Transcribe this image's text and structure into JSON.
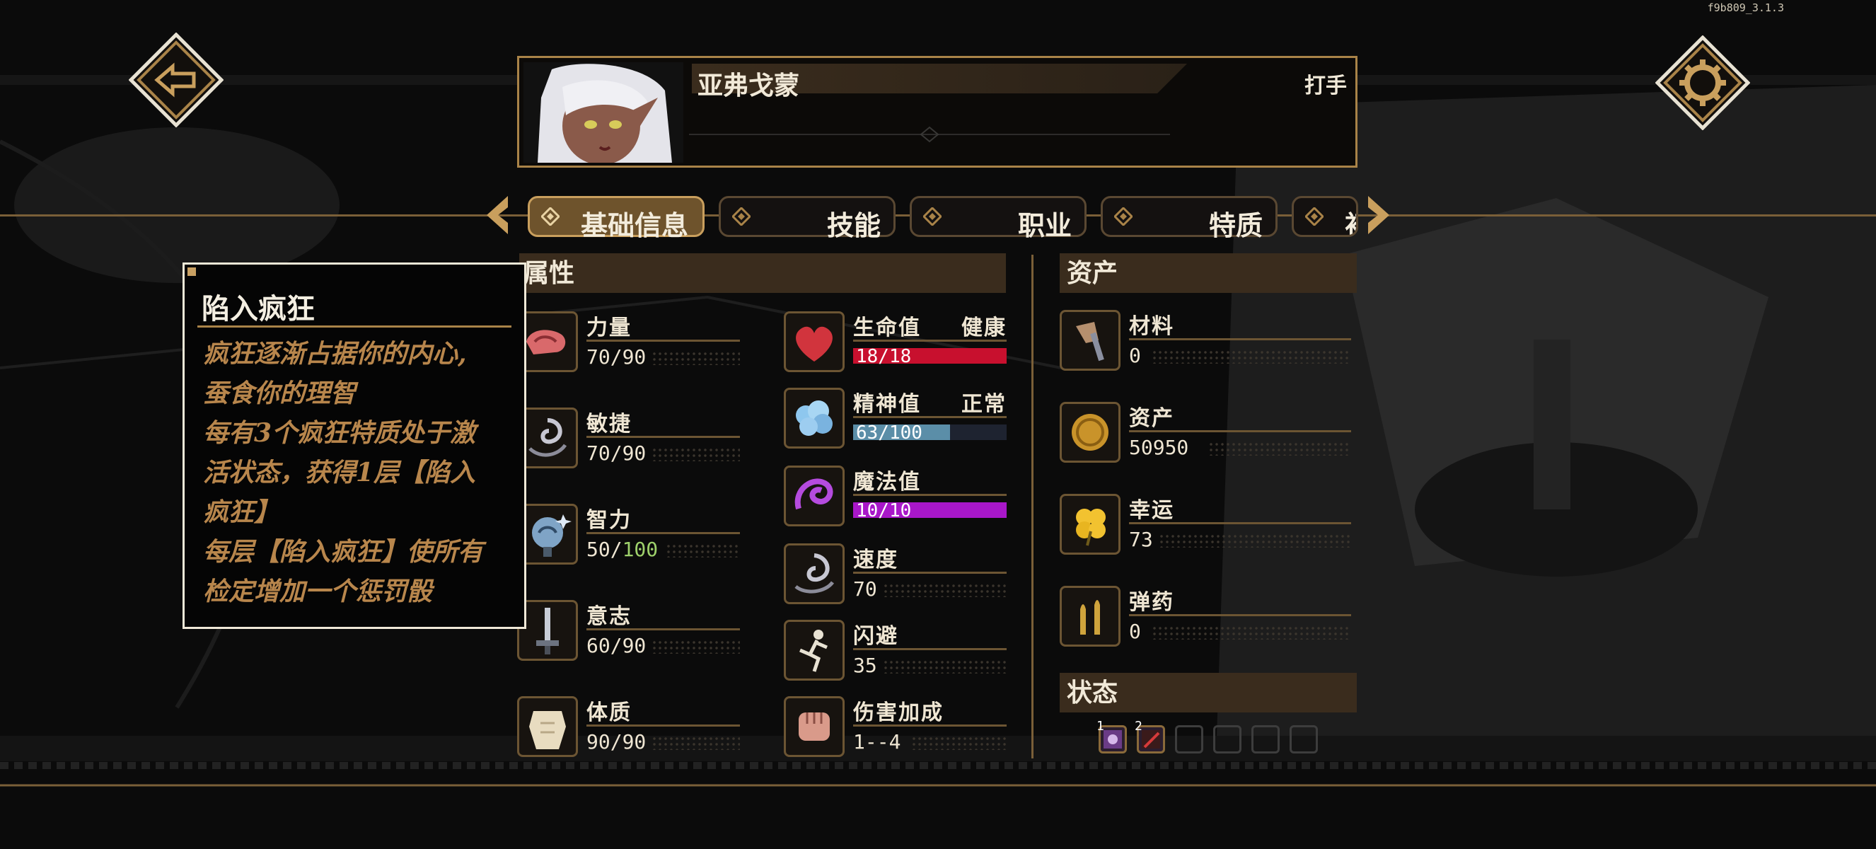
{
  "version": "f9b809_3.1.3",
  "character": {
    "name": "亚弗戈蒙",
    "class": "打手"
  },
  "tabs": [
    {
      "label": "基础信息",
      "active": true
    },
    {
      "label": "技能",
      "active": false
    },
    {
      "label": "职业",
      "active": false
    },
    {
      "label": "特质",
      "active": false
    },
    {
      "label": "初",
      "active": false
    }
  ],
  "sections": {
    "attributes": "属性",
    "assets": "资产",
    "status": "状态"
  },
  "attributes": [
    {
      "icon": "arm-muscle-icon",
      "name": "力量",
      "value": "70/90"
    },
    {
      "icon": "swirl-agility-icon",
      "name": "敏捷",
      "value": "70/90"
    },
    {
      "icon": "brain-head-icon",
      "name": "智力",
      "value_main": "50/",
      "value_hi": "100"
    },
    {
      "icon": "sword-will-icon",
      "name": "意志",
      "value": "60/90"
    },
    {
      "icon": "torso-constitution-icon",
      "name": "体质",
      "value": "90/90"
    }
  ],
  "vitals": [
    {
      "icon": "heart-icon",
      "name": "生命值",
      "state": "健康",
      "value": "18/18",
      "fraction": 1.0,
      "color": "#c8102e"
    },
    {
      "icon": "brain-sanity-icon",
      "name": "精神值",
      "state": "正常",
      "value": "63/100",
      "fraction": 0.63,
      "color": "#5b8ea8"
    },
    {
      "icon": "magic-swirl-icon",
      "name": "魔法值",
      "value": "10/10",
      "fraction": 1.0,
      "color": "#a817c9"
    },
    {
      "icon": "speed-swirl-icon",
      "name": "速度",
      "value": "70"
    },
    {
      "icon": "dodge-figure-icon",
      "name": "闪避",
      "value": "35"
    },
    {
      "icon": "fist-icon",
      "name": "伤害加成",
      "value": "1--4"
    }
  ],
  "assets": [
    {
      "icon": "material-icon",
      "name": "材料",
      "value": "0"
    },
    {
      "icon": "gold-coin-icon",
      "name": "资产",
      "value": "50950"
    },
    {
      "icon": "luck-clover-icon",
      "name": "幸运",
      "value": "73"
    },
    {
      "icon": "ammo-icon",
      "name": "弹药",
      "value": "0"
    }
  ],
  "status_effects": [
    {
      "icon": "madness-icon",
      "count": "1"
    },
    {
      "icon": "bleed-icon",
      "count": "2"
    }
  ],
  "tooltip": {
    "title": "陷入疯狂",
    "lines": [
      "疯狂逐渐占据你的内心,",
      "蚕食你的理智",
      "每有3个疯狂特质处于激",
      "活状态，获得1层【陷入",
      "疯狂】",
      "每层【陷入疯狂】使所有",
      "检定增加一个惩罚骰"
    ]
  },
  "colors": {
    "gold": "#a98348",
    "panel": "#3a2c1d",
    "accent_text": "#b8864c"
  }
}
